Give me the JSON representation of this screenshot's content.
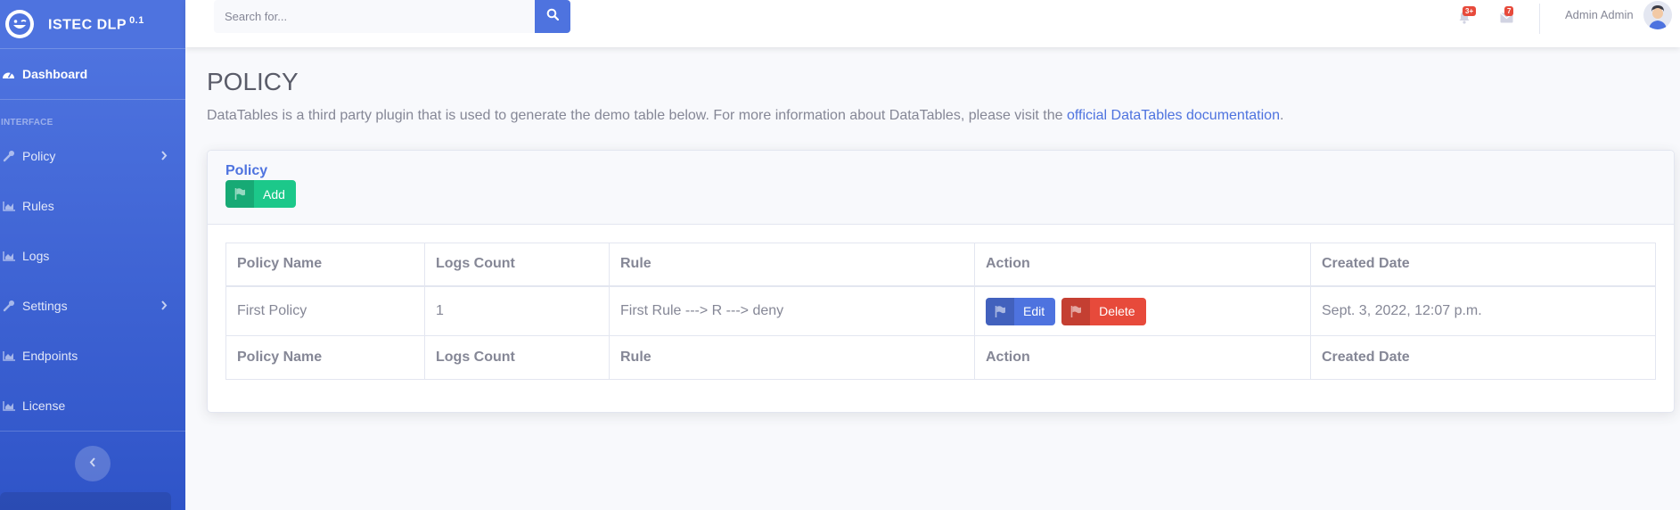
{
  "brand": {
    "name": "ISTEC DLP",
    "version": "0.1",
    "logo_icon": "laugh-wink-icon"
  },
  "sidebar": {
    "dashboard": "Dashboard",
    "heading": "INTERFACE",
    "items": [
      {
        "label": "Policy",
        "icon": "wrench-icon",
        "has_chevron": true
      },
      {
        "label": "Rules",
        "icon": "chart-area-icon",
        "has_chevron": false
      },
      {
        "label": "Logs",
        "icon": "chart-area-icon",
        "has_chevron": false
      },
      {
        "label": "Settings",
        "icon": "wrench-icon",
        "has_chevron": true
      },
      {
        "label": "Endpoints",
        "icon": "chart-area-icon",
        "has_chevron": false
      },
      {
        "label": "License",
        "icon": "chart-area-icon",
        "has_chevron": false
      }
    ]
  },
  "topbar": {
    "search_placeholder": "Search for...",
    "alerts_badge": "3+",
    "messages_badge": "7",
    "user_name": "Admin Admin"
  },
  "page": {
    "title": "POLICY",
    "desc_prefix": "DataTables is a third party plugin that is used to generate the demo table below. For more information about DataTables, please visit the ",
    "desc_link": "official DataTables documentation",
    "desc_suffix": "."
  },
  "card": {
    "title": "Policy",
    "add_label": "Add"
  },
  "table": {
    "columns": [
      "Policy Name",
      "Logs Count",
      "Rule",
      "Action",
      "Created Date"
    ],
    "rows": [
      {
        "policy_name": "First Policy",
        "logs_count": "1",
        "rule": "First Rule ---> R ---> deny",
        "edit_label": "Edit",
        "delete_label": "Delete",
        "created_date": "Sept. 3, 2022, 12:07 p.m."
      }
    ]
  },
  "colors": {
    "primary": "#4e73df",
    "success": "#1cc88a",
    "danger": "#e74a3b"
  }
}
